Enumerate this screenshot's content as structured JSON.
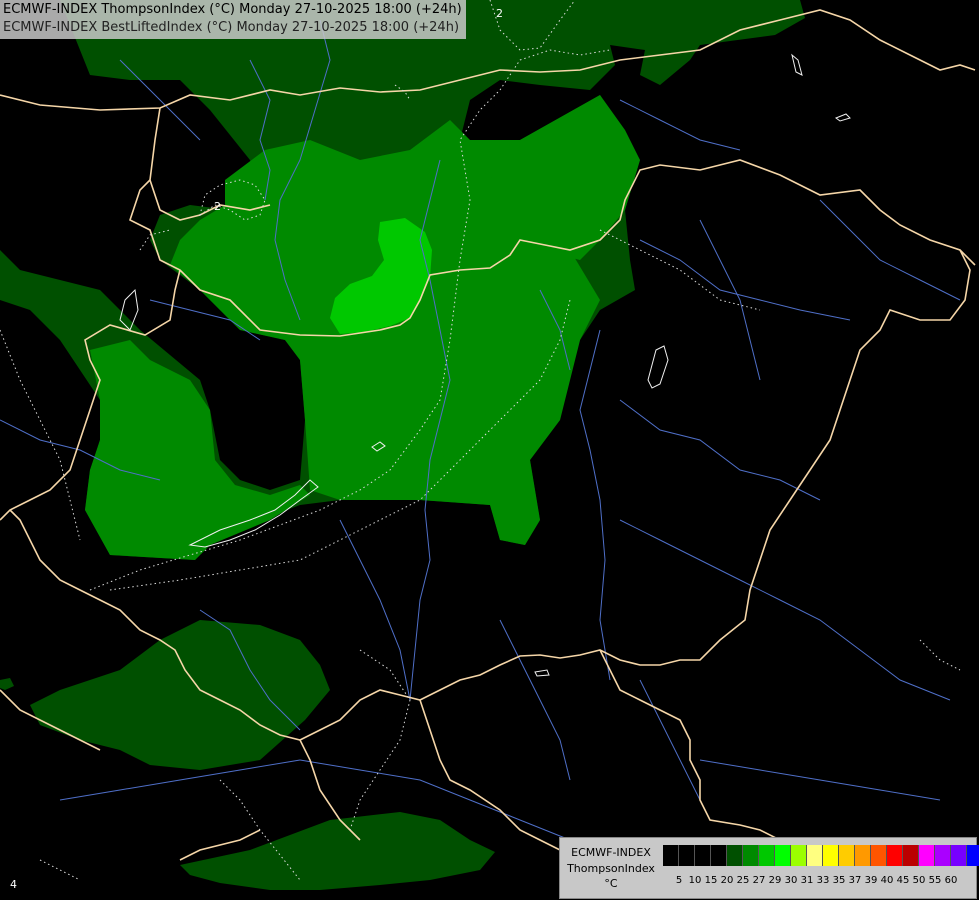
{
  "header": {
    "line1": "ECMWF-INDEX ThompsonIndex (°C) Monday 27-10-2025 18:00 (+24h)",
    "line2": "ECMWF-INDEX BestLiftedIndex (°C) Monday 27-10-2025 18:00 (+24h)"
  },
  "legend": {
    "title": "ECMWF-INDEX",
    "param": "ThompsonIndex",
    "unit": "°C",
    "ticks": [
      "5",
      "10",
      "15",
      "20",
      "25",
      "27",
      "29",
      "30",
      "31",
      "33",
      "35",
      "37",
      "39",
      "40",
      "45",
      "50",
      "55",
      "60"
    ],
    "colors": [
      "#000000",
      "#000000",
      "#000000",
      "#000000",
      "#005000",
      "#008a00",
      "#00c800",
      "#00ff00",
      "#9bff00",
      "#ffff80",
      "#ffff00",
      "#ffcc00",
      "#ff9900",
      "#ff5500",
      "#ff0000",
      "#bb0000",
      "#ff00ff",
      "#aa00ff",
      "#7700ff",
      "#0000ff"
    ]
  },
  "contour_labels": [
    "2",
    "2",
    "4"
  ],
  "map_colors": {
    "background": "#000000",
    "thompson_20_25": "#005000",
    "thompson_25_27": "#008a00",
    "thompson_27_29": "#00c800",
    "borders": "#f5d6a8",
    "rivers": "#4f6fc8",
    "lifted_contours": "#dcdcdc"
  }
}
